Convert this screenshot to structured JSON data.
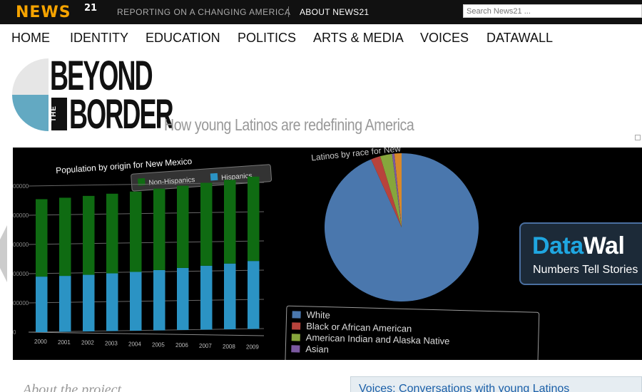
{
  "topbar": {
    "logo_text": "NEWS",
    "logo_number": "21",
    "tagline": "REPORTING ON A CHANGING AMERICA",
    "about_link": "ABOUT NEWS21",
    "search_placeholder": "Search News21 ..."
  },
  "nav": {
    "items": [
      "HOME",
      "IDENTITY",
      "EDUCATION",
      "POLITICS",
      "ARTS & MEDIA",
      "VOICES",
      "DATAWALL"
    ]
  },
  "banner": {
    "title_top": "BEYOND",
    "title_mid": "THE",
    "title_bottom": "BORDER",
    "subtitle": "How young Latinos are redefining America",
    "colors": {
      "circle_gray": "#e6e6e6",
      "circle_blue": "#63a9c2"
    }
  },
  "chart_data": [
    {
      "type": "bar",
      "title": "Population by origin for New Mexico",
      "categories": [
        "2000",
        "2001",
        "2002",
        "2003",
        "2004",
        "2005",
        "2006",
        "2007",
        "2008",
        "2009"
      ],
      "series": [
        {
          "name": "Hispanics",
          "color": "#2b93c4",
          "values": [
            760000,
            765000,
            775000,
            790000,
            805000,
            825000,
            850000,
            875000,
            900000,
            930000
          ]
        },
        {
          "name": "Non-Hispanics",
          "color": "#0f6b12",
          "values": [
            1060000,
            1070000,
            1080000,
            1090000,
            1100000,
            1115000,
            1125000,
            1135000,
            1145000,
            1155000
          ]
        }
      ],
      "stacked": true,
      "ylim": [
        0,
        2000000
      ],
      "yticks": [
        "0",
        "00000",
        "00000",
        "00000",
        "00000",
        "00000"
      ],
      "legend_position": "top"
    },
    {
      "type": "pie",
      "title": "Latinos by race for New",
      "slices": [
        {
          "label": "White",
          "value": 93.5,
          "color": "#4a77ad"
        },
        {
          "label": "Black or African American",
          "value": 2.0,
          "color": "#b8433c"
        },
        {
          "label": "American Indian and Alaska Native",
          "value": 2.5,
          "color": "#86a63c"
        },
        {
          "label": "Asian",
          "value": 0.5,
          "color": "#7b59a0"
        },
        {
          "label": "",
          "value": 1.5,
          "color": "#d8882a"
        }
      ],
      "legend_position": "bottom"
    }
  ],
  "datawall_badge": {
    "title_blue": "Data",
    "title_white": "Wal",
    "subtitle": "Numbers Tell Stories",
    "arrow_icon": "play-arrow-icon"
  },
  "bottom": {
    "about_heading": "About the project",
    "voices_link": "Voices: Conversations with young Latinos"
  }
}
